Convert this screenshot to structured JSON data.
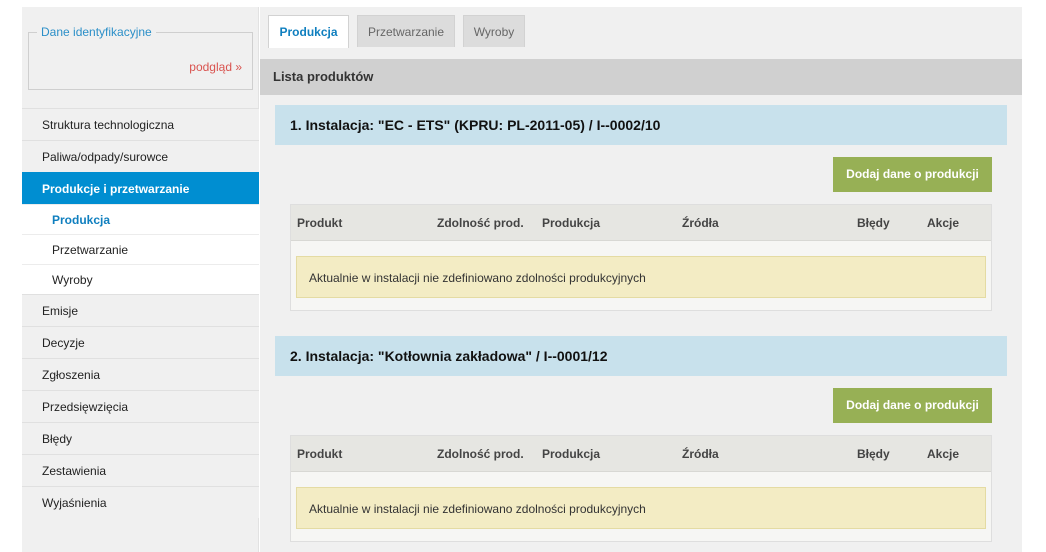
{
  "sidebar": {
    "ident_title": "Dane identyfikacyjne",
    "ident_link": "podgląd »",
    "menu": [
      {
        "label": "Struktura technologiczna"
      },
      {
        "label": "Paliwa/odpady/surowce"
      },
      {
        "label": "Produkcje i przetwarzanie"
      },
      {
        "label": "Produkcja"
      },
      {
        "label": "Przetwarzanie"
      },
      {
        "label": "Wyroby"
      },
      {
        "label": "Emisje"
      },
      {
        "label": "Decyzje"
      },
      {
        "label": "Zgłoszenia"
      },
      {
        "label": "Przedsięwzięcia"
      },
      {
        "label": "Błędy"
      },
      {
        "label": "Zestawienia"
      },
      {
        "label": "Wyjaśnienia"
      }
    ]
  },
  "tabs": [
    {
      "label": "Produkcja"
    },
    {
      "label": "Przetwarzanie"
    },
    {
      "label": "Wyroby"
    }
  ],
  "main": {
    "list_title": "Lista produktów",
    "add_button_label": "Dodaj dane o produkcji",
    "columns": [
      "Produkt",
      "Zdolność prod.",
      "Produkcja",
      "Źródła",
      "Błędy",
      "Akcje"
    ],
    "installations": [
      {
        "title": "1. Instalacja: \"EC - ETS\" (KPRU: PL-2011-05) / I--0002/10",
        "notice": "Aktualnie w instalacji nie zdefiniowano zdolności produkcyjnych"
      },
      {
        "title": "2. Instalacja: \"Kotłownia zakładowa\" / I--0001/12",
        "notice": "Aktualnie w instalacji nie zdefiniowano zdolności produkcyjnych"
      }
    ]
  },
  "colors": {
    "accent": "#008ed1",
    "tab_active_text": "#0f7fbf",
    "install_header_bg": "#c8e1ec",
    "button_bg": "#97b055",
    "notice_bg": "#f3ecc4",
    "preview_link": "#d9534f"
  }
}
